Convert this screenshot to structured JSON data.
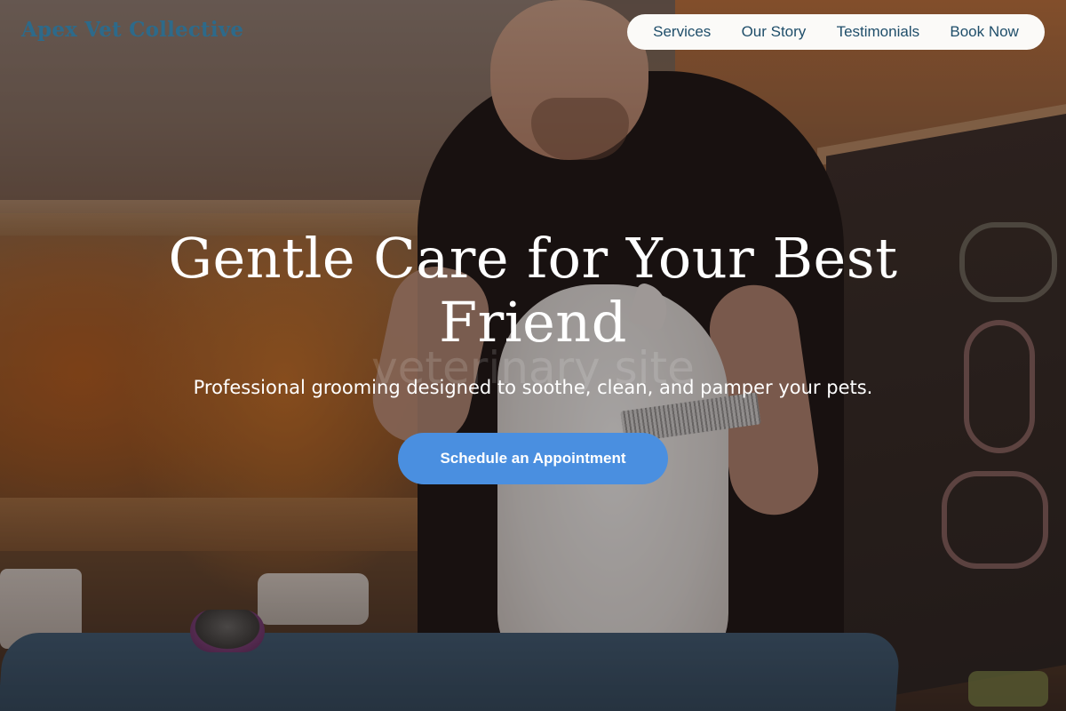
{
  "header": {
    "logo": "Apex Vet Collective",
    "nav": [
      "Services",
      "Our Story",
      "Testimonials",
      "Book Now"
    ]
  },
  "hero": {
    "title": "Gentle Care for Your Best Friend",
    "subtitle": "Professional grooming designed to soothe, clean, and pamper your pets.",
    "watermark": "veterinary site",
    "cta_label": "Schedule an Appointment"
  },
  "colors": {
    "logo": "#2d6a8a",
    "nav_text": "#1f4e6a",
    "cta_bg": "#4a8fe0"
  }
}
